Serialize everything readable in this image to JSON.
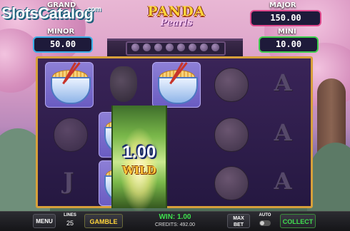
{
  "watermark": {
    "text": "SlotsCatalog",
    "domain": ".com"
  },
  "logo": {
    "line1": "PANDA",
    "line2": "Pearls"
  },
  "jackpots": {
    "grand_label": "GRAND",
    "minor_label": "MINOR",
    "minor_value": "50.00",
    "major_label": "MAJOR",
    "major_value": "150.00",
    "mini_label": "MINI",
    "mini_value": "10.00"
  },
  "reels": [
    [
      "noodle-bowl",
      "peach",
      "letter-j"
    ],
    [
      "gourd",
      "noodle-bowl",
      "noodle-bowl"
    ],
    [
      "noodle-bowl",
      "wild",
      "wild"
    ],
    [
      "peach",
      "peach",
      "peach"
    ],
    [
      "letter-a",
      "letter-a",
      "letter-a"
    ]
  ],
  "wild": {
    "amount": "1.00",
    "label": "WILD"
  },
  "bottom_bar": {
    "menu_label": "MENU",
    "lines_label": "LINES",
    "lines_value": "25",
    "gamble_label": "GAMBLE",
    "win_text": "WIN: 1.00",
    "credits_text": "CREDITS: 492.00",
    "max_bet_label": "MAX BET",
    "auto_label": "AUTO",
    "collect_label": "COLLECT"
  },
  "colors": {
    "frame": "#d7a03a",
    "win": "#3fe04e",
    "major": "#e0488c",
    "mini": "#3fcf4e",
    "grand": "#3ab0e8"
  }
}
